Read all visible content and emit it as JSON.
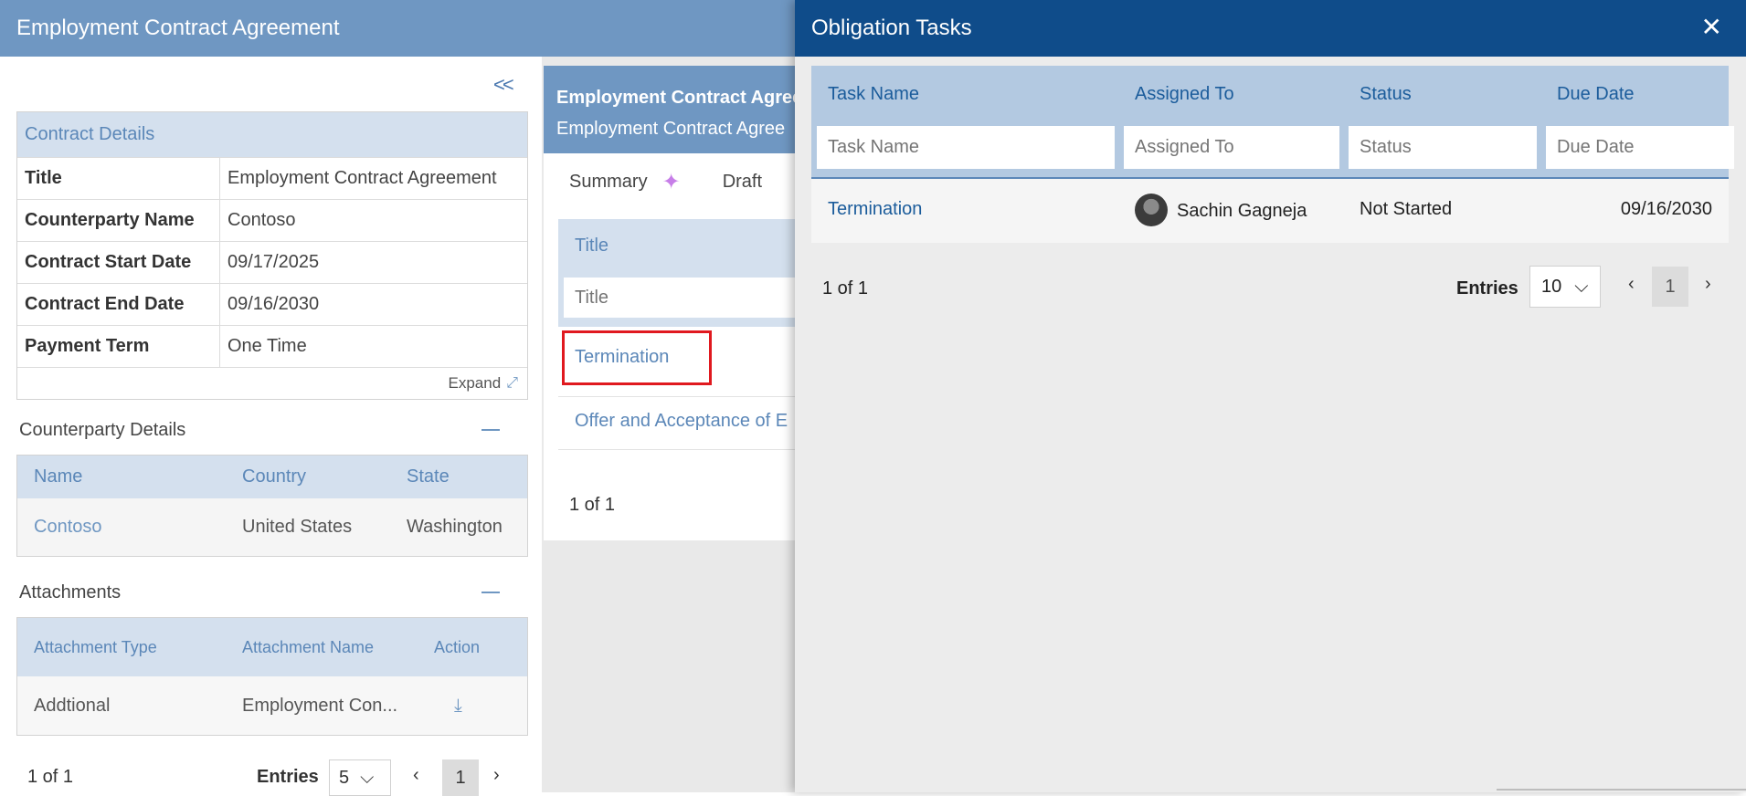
{
  "app": {
    "title": "Employment Contract Agreement"
  },
  "left": {
    "collapse": "<<",
    "contract_details": {
      "title": "Contract Details",
      "rows": [
        {
          "key": "Title",
          "value": "Employment Contract Agreement"
        },
        {
          "key": "Counterparty Name",
          "value": "Contoso"
        },
        {
          "key": "Contract Start Date",
          "value": "09/17/2025"
        },
        {
          "key": "Contract End Date",
          "value": "09/16/2030"
        },
        {
          "key": "Payment Term",
          "value": "One Time"
        }
      ],
      "expand": "Expand"
    },
    "counterparty": {
      "title": "Counterparty Details",
      "headers": [
        "Name",
        "Country",
        "State"
      ],
      "row": [
        "Contoso",
        "United States",
        "Washington"
      ]
    },
    "attachments": {
      "title": "Attachments",
      "headers": [
        "Attachment Type",
        "Attachment Name",
        "Action"
      ],
      "row": [
        "Addtional",
        "Employment Con..."
      ]
    },
    "pager": {
      "count": "1 of 1",
      "entries_label": "Entries",
      "entries_value": "5",
      "page": "1"
    }
  },
  "center": {
    "header_line1": "Employment Contract Agree",
    "header_line2": "Employment Contract Agree",
    "tabs": [
      "Summary",
      "Draft"
    ],
    "filter_label": "Title",
    "filter_placeholder": "Title",
    "items": [
      "Termination",
      "Offer and Acceptance of E"
    ],
    "pager": "1 of 1"
  },
  "obligation": {
    "title": "Obligation Tasks",
    "close": "✕",
    "columns": [
      "Task Name",
      "Assigned To",
      "Status",
      "Due Date"
    ],
    "placeholders": [
      "Task Name",
      "Assigned To",
      "Status",
      "Due Date"
    ],
    "row": {
      "task": "Termination",
      "assigned": "Sachin Gagneja",
      "status": "Not Started",
      "due": "09/16/2030"
    },
    "pager": {
      "count": "1 of 1",
      "entries_label": "Entries",
      "entries_value": "10",
      "page": "1"
    }
  },
  "colors": {
    "header": "#6f97c2",
    "panel_header": "#0f4c8a",
    "link": "#1b5c9b",
    "highlight": "#e0191f"
  },
  "icons": [
    "collapse-icon",
    "expand-icon",
    "minus-icon",
    "download-icon",
    "sparkle-icon",
    "close-icon",
    "chevron-down-icon",
    "chevron-left-icon",
    "chevron-right-icon"
  ]
}
